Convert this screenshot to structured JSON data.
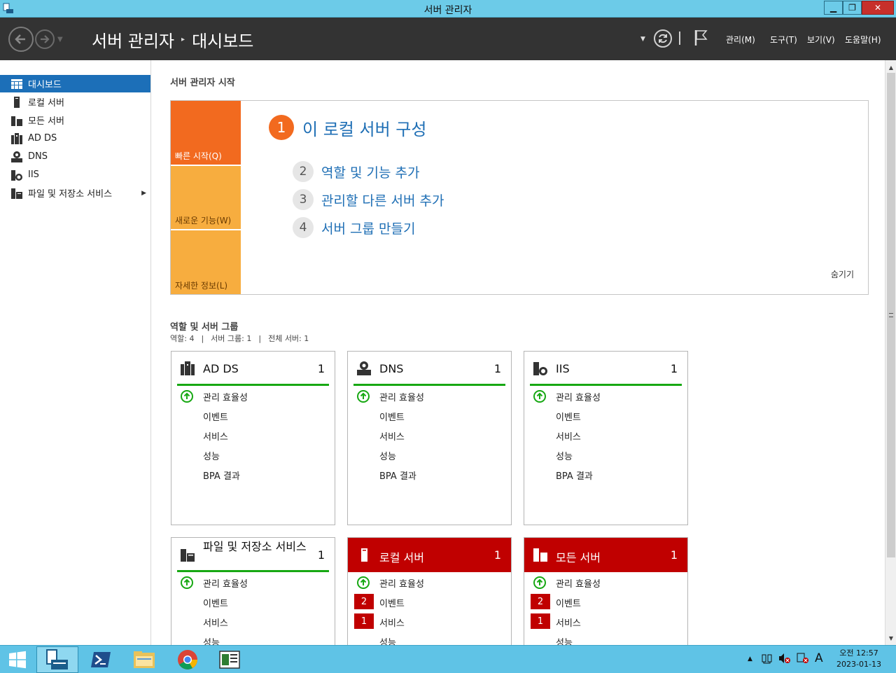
{
  "window": {
    "title": "서버 관리자",
    "min": "▁",
    "max": "❐",
    "close": "✕"
  },
  "header": {
    "breadcrumb_root": "서버 관리자",
    "breadcrumb_sep": "▸",
    "breadcrumb_page": "대시보드",
    "menu": [
      "관리(M)",
      "도구(T)",
      "보기(V)",
      "도움말(H)"
    ]
  },
  "sidebar": {
    "items": [
      {
        "label": "대시보드",
        "icon": "dashboard-icon",
        "active": true
      },
      {
        "label": "로컬 서버",
        "icon": "server-icon"
      },
      {
        "label": "모든 서버",
        "icon": "servers-icon"
      },
      {
        "label": "AD DS",
        "icon": "ad-ds-icon"
      },
      {
        "label": "DNS",
        "icon": "dns-icon"
      },
      {
        "label": "IIS",
        "icon": "iis-icon"
      },
      {
        "label": "파일 및 저장소 서비스",
        "icon": "file-storage-icon",
        "expand": "▶"
      }
    ]
  },
  "welcome": {
    "section_title": "서버 관리자 시작",
    "tiles": [
      "빠른 시작(Q)",
      "새로운 기능(W)",
      "자세한 정보(L)"
    ],
    "step1": {
      "num": "1",
      "label": "이 로컬 서버 구성"
    },
    "steps": [
      {
        "num": "2",
        "label": "역할 및 기능 추가"
      },
      {
        "num": "3",
        "label": "관리할 다른 서버 추가"
      },
      {
        "num": "4",
        "label": "서버 그룹 만들기"
      }
    ],
    "hide": "숨기기"
  },
  "roles": {
    "section_title": "역할 및 서버 그룹",
    "roles_count": "역할: 4",
    "sep": "|",
    "groups_count": "서버 그룹: 1",
    "servers_count": "전체 서버: 1"
  },
  "cards": [
    {
      "name": "AD DS",
      "count": "1",
      "rows": [
        "관리 효율성",
        "이벤트",
        "서비스",
        "성능",
        "BPA 결과"
      ]
    },
    {
      "name": "DNS",
      "count": "1",
      "rows": [
        "관리 효율성",
        "이벤트",
        "서비스",
        "성능",
        "BPA 결과"
      ]
    },
    {
      "name": "IIS",
      "count": "1",
      "rows": [
        "관리 효율성",
        "이벤트",
        "서비스",
        "성능",
        "BPA 결과"
      ]
    },
    {
      "name": "파일 및 저장소 서비스",
      "count": "1",
      "rows": [
        "관리 효율성",
        "이벤트",
        "서비스",
        "성능"
      ]
    },
    {
      "name": "로컬 서버",
      "count": "1",
      "rows": [
        "관리 효율성",
        "이벤트",
        "서비스",
        "성능"
      ],
      "badges": [
        "",
        "2",
        "1",
        ""
      ]
    },
    {
      "name": "모든 서버",
      "count": "1",
      "rows": [
        "관리 효율성",
        "이벤트",
        "서비스",
        "성능"
      ],
      "badges": [
        "",
        "2",
        "1",
        ""
      ]
    }
  ],
  "colors": {
    "accent": "#1c6fb8",
    "header": "#333333",
    "orange": "#f26a1f",
    "ok_green": "#17a813",
    "alert_red": "#c00000"
  },
  "taskbar": {
    "apps": [
      "start-icon",
      "server-manager-icon",
      "powershell-icon",
      "file-explorer-icon",
      "chrome-icon",
      "tools-icon"
    ],
    "tray_arrow": "▲",
    "ime": "A",
    "time": "오전 12:57",
    "date": "2023-01-13"
  }
}
